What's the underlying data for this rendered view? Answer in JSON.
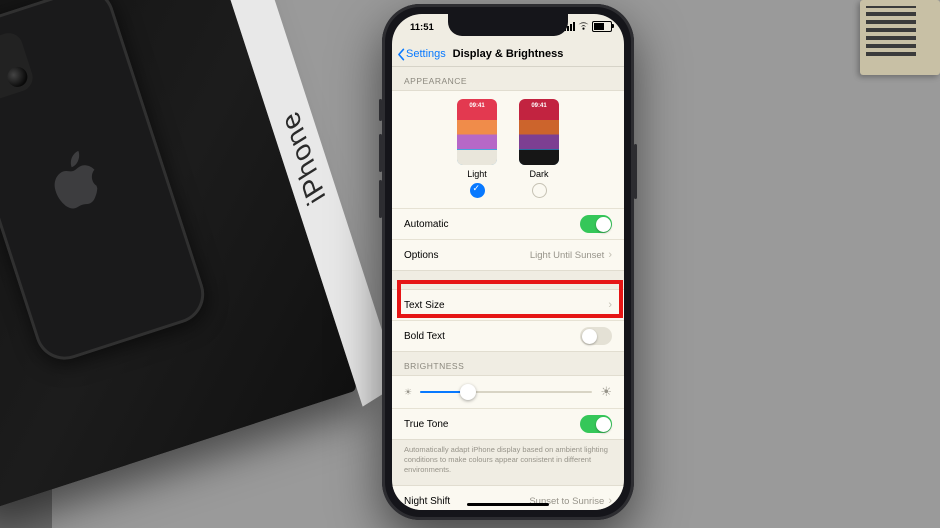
{
  "status": {
    "time": "11:51"
  },
  "nav": {
    "back": "Settings",
    "title": "Display & Brightness"
  },
  "appearance": {
    "header": "APPEARANCE",
    "thumb_time": "09:41",
    "light_label": "Light",
    "dark_label": "Dark",
    "automatic_label": "Automatic",
    "options_label": "Options",
    "options_value": "Light Until Sunset"
  },
  "text": {
    "size_label": "Text Size",
    "bold_label": "Bold Text"
  },
  "brightness": {
    "header": "BRIGHTNESS",
    "value_pct": 28,
    "truetone_label": "True Tone",
    "footnote": "Automatically adapt iPhone display based on ambient lighting conditions to make colours appear consistent in different environments."
  },
  "nightshift": {
    "label": "Night Shift",
    "value": "Sunset to Sunrise"
  },
  "box_side": "iPhone"
}
